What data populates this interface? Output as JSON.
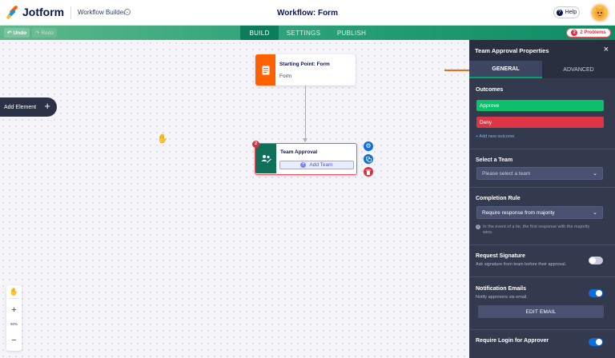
{
  "app": {
    "brand": "Jotform",
    "section": "Workflow Builder",
    "title": "Workflow: Form",
    "help_label": "Help"
  },
  "toolbar": {
    "undo_label": "Undo",
    "redo_label": "Redo",
    "tabs": [
      {
        "label": "BUILD",
        "active": true
      },
      {
        "label": "SETTINGS",
        "active": false
      },
      {
        "label": "PUBLISH",
        "active": false
      }
    ],
    "problems_count": "2",
    "problems_label": "Problems"
  },
  "canvas": {
    "add_element_label": "Add Element",
    "start_node": {
      "title": "Starting Point: Form",
      "subtitle": "Form"
    },
    "approval_node": {
      "title": "Team Approval",
      "add_team_label": "Add Team",
      "badge": "2"
    },
    "zoom_level": "50%"
  },
  "panel": {
    "title": "Team Approval Properties",
    "tabs": [
      {
        "label": "GENERAL",
        "active": true
      },
      {
        "label": "ADVANCED",
        "active": false
      }
    ],
    "outcomes_title": "Outcomes",
    "outcomes": [
      {
        "label": "Approve",
        "color": "#0bbf6b"
      },
      {
        "label": "Deny",
        "color": "#dc3545"
      }
    ],
    "add_outcome_label": "+ Add new outcome",
    "select_team_title": "Select a Team",
    "select_team_placeholder": "Please select a team",
    "completion_rule_title": "Completion Rule",
    "completion_rule_value": "Require response from majority",
    "completion_note": "In the event of a tie, the first response with the majority wins.",
    "request_signature_title": "Request Signature",
    "request_signature_desc": "Ask signature from team before their approval.",
    "request_signature_on": false,
    "notification_title": "Notification Emails",
    "notification_desc": "Notify approvers via email.",
    "notification_on": true,
    "edit_email_label": "EDIT EMAIL",
    "require_login_title": "Require Login for Approver",
    "require_login_on": true
  },
  "colors": {
    "green_accent": "#0aa06e",
    "orange": "#ff6100",
    "danger": "#e0303e",
    "toggle_on": "#0a6fe0",
    "panel_bg": "#343a4d"
  }
}
